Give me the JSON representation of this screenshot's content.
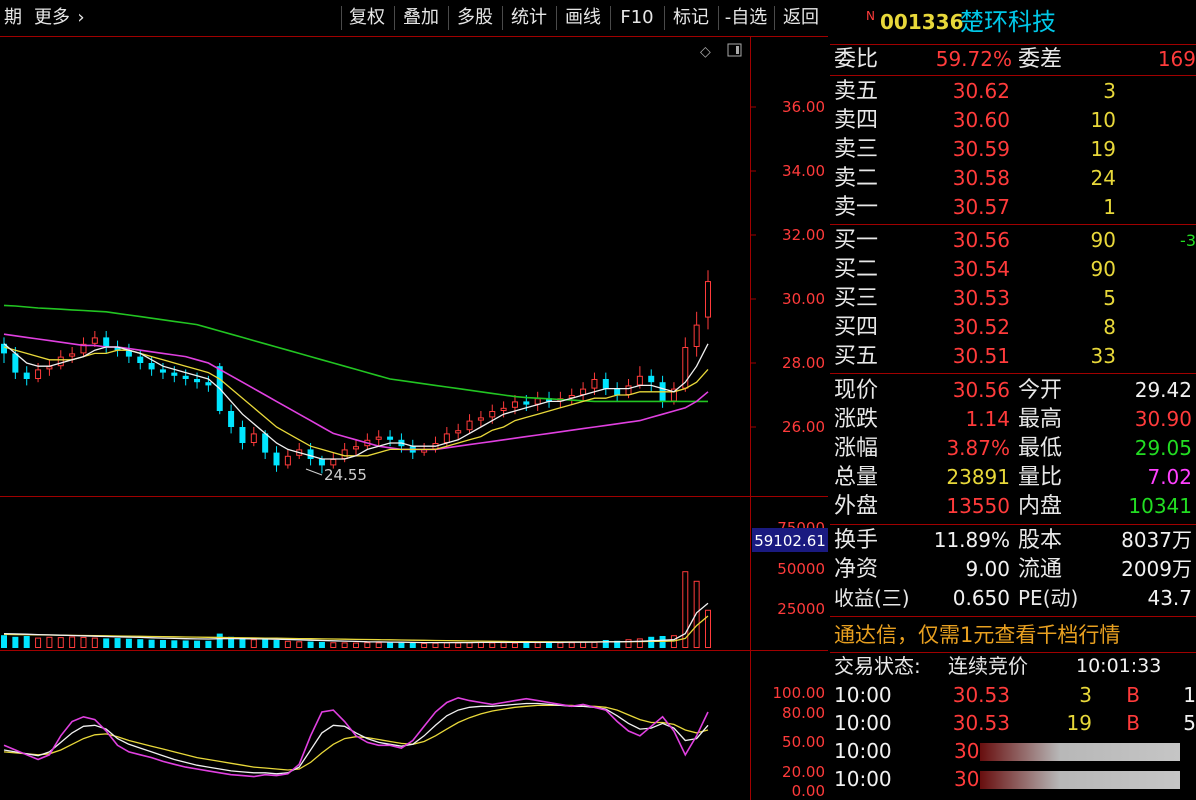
{
  "toolbar": {
    "left_cut": "期",
    "more": "更多",
    "buttons": [
      "复权",
      "叠加",
      "多股",
      "统计",
      "画线",
      "F10",
      "标记",
      "-自选",
      "返回"
    ]
  },
  "chart_labels": {
    "price_ticks": [
      "36.00",
      "34.00",
      "32.00",
      "30.00",
      "28.00",
      "26.00"
    ],
    "low_mark": "24.55",
    "vol_ticks": [
      "75000",
      "50000",
      "25000"
    ],
    "vol_cursor": "59102.61",
    "kdj_ticks": [
      "100.00",
      "80.00",
      "50.00",
      "20.00",
      "0.00"
    ]
  },
  "chart_data": {
    "type": "candlestick",
    "ylim": [
      24.0,
      37.0
    ],
    "candles": [
      [
        28.6,
        28.3,
        28.8,
        28.0
      ],
      [
        28.3,
        27.7,
        28.5,
        27.5
      ],
      [
        27.7,
        27.5,
        27.9,
        27.3
      ],
      [
        27.5,
        27.8,
        28.0,
        27.4
      ],
      [
        27.8,
        27.9,
        28.1,
        27.6
      ],
      [
        27.9,
        28.2,
        28.4,
        27.8
      ],
      [
        28.2,
        28.3,
        28.5,
        28.0
      ],
      [
        28.3,
        28.6,
        28.8,
        28.2
      ],
      [
        28.6,
        28.8,
        29.0,
        28.5
      ],
      [
        28.8,
        28.5,
        29.0,
        28.3
      ],
      [
        28.5,
        28.4,
        28.7,
        28.2
      ],
      [
        28.4,
        28.2,
        28.6,
        28.0
      ],
      [
        28.2,
        28.0,
        28.4,
        27.8
      ],
      [
        28.0,
        27.8,
        28.2,
        27.6
      ],
      [
        27.8,
        27.7,
        28.0,
        27.5
      ],
      [
        27.7,
        27.6,
        27.9,
        27.4
      ],
      [
        27.6,
        27.5,
        27.8,
        27.3
      ],
      [
        27.5,
        27.4,
        27.7,
        27.2
      ],
      [
        27.4,
        27.3,
        27.6,
        27.1
      ],
      [
        27.9,
        26.5,
        28.0,
        26.4
      ],
      [
        26.5,
        26.0,
        26.7,
        25.8
      ],
      [
        26.0,
        25.5,
        26.2,
        25.3
      ],
      [
        25.5,
        25.8,
        26.0,
        25.4
      ],
      [
        25.8,
        25.2,
        25.9,
        25.0
      ],
      [
        25.2,
        24.8,
        25.4,
        24.6
      ],
      [
        24.8,
        25.1,
        25.3,
        24.7
      ],
      [
        25.1,
        25.3,
        25.5,
        25.0
      ],
      [
        25.3,
        25.0,
        25.5,
        24.8
      ],
      [
        25.0,
        24.8,
        25.1,
        24.55
      ],
      [
        24.8,
        25.0,
        25.2,
        24.7
      ],
      [
        25.0,
        25.3,
        25.5,
        24.9
      ],
      [
        25.3,
        25.4,
        25.6,
        25.1
      ],
      [
        25.4,
        25.6,
        25.8,
        25.3
      ],
      [
        25.6,
        25.7,
        25.9,
        25.4
      ],
      [
        25.7,
        25.6,
        25.9,
        25.4
      ],
      [
        25.6,
        25.4,
        25.8,
        25.2
      ],
      [
        25.4,
        25.2,
        25.6,
        25.0
      ],
      [
        25.2,
        25.3,
        25.5,
        25.1
      ],
      [
        25.3,
        25.5,
        25.7,
        25.2
      ],
      [
        25.5,
        25.8,
        26.0,
        25.4
      ],
      [
        25.8,
        25.9,
        26.1,
        25.6
      ],
      [
        25.9,
        26.2,
        26.4,
        25.8
      ],
      [
        26.2,
        26.3,
        26.5,
        26.0
      ],
      [
        26.3,
        26.5,
        26.7,
        26.1
      ],
      [
        26.5,
        26.6,
        26.8,
        26.3
      ],
      [
        26.6,
        26.8,
        27.0,
        26.4
      ],
      [
        26.8,
        26.7,
        27.0,
        26.5
      ],
      [
        26.7,
        26.9,
        27.1,
        26.5
      ],
      [
        26.9,
        26.8,
        27.1,
        26.6
      ],
      [
        26.8,
        26.9,
        27.1,
        26.6
      ],
      [
        26.9,
        27.0,
        27.2,
        26.7
      ],
      [
        27.0,
        27.2,
        27.4,
        26.8
      ],
      [
        27.2,
        27.5,
        27.7,
        27.0
      ],
      [
        27.5,
        27.2,
        27.7,
        27.0
      ],
      [
        27.2,
        27.0,
        27.4,
        26.8
      ],
      [
        27.0,
        27.3,
        27.5,
        26.9
      ],
      [
        27.3,
        27.6,
        27.9,
        27.2
      ],
      [
        27.6,
        27.4,
        27.8,
        27.1
      ],
      [
        27.4,
        26.8,
        27.6,
        26.6
      ],
      [
        26.8,
        27.2,
        27.4,
        26.7
      ],
      [
        27.2,
        28.5,
        28.8,
        27.1
      ],
      [
        28.5,
        29.2,
        29.6,
        28.2
      ],
      [
        29.42,
        30.56,
        30.9,
        29.05
      ]
    ],
    "ma_short": [
      28.6,
      28.3,
      28.0,
      27.9,
      27.9,
      28.0,
      28.1,
      28.2,
      28.4,
      28.5,
      28.5,
      28.4,
      28.3,
      28.1,
      27.9,
      27.8,
      27.7,
      27.6,
      27.5,
      27.2,
      26.8,
      26.4,
      26.1,
      25.8,
      25.5,
      25.3,
      25.2,
      25.1,
      25.0,
      25.0,
      25.0,
      25.1,
      25.3,
      25.4,
      25.5,
      25.5,
      25.4,
      25.4,
      25.4,
      25.5,
      25.6,
      25.8,
      26.0,
      26.2,
      26.4,
      26.5,
      26.6,
      26.7,
      26.8,
      26.8,
      26.9,
      27.0,
      27.1,
      27.2,
      27.2,
      27.2,
      27.3,
      27.3,
      27.2,
      27.1,
      27.4,
      27.9,
      28.6
    ],
    "ma_mid": [
      28.5,
      28.4,
      28.3,
      28.2,
      28.1,
      28.1,
      28.1,
      28.2,
      28.3,
      28.3,
      28.4,
      28.4,
      28.3,
      28.2,
      28.1,
      28.0,
      27.9,
      27.8,
      27.7,
      27.5,
      27.2,
      26.9,
      26.6,
      26.3,
      26.0,
      25.8,
      25.6,
      25.4,
      25.3,
      25.2,
      25.1,
      25.1,
      25.1,
      25.2,
      25.3,
      25.3,
      25.3,
      25.3,
      25.3,
      25.4,
      25.5,
      25.6,
      25.7,
      25.9,
      26.0,
      26.2,
      26.3,
      26.4,
      26.5,
      26.6,
      26.7,
      26.8,
      26.9,
      26.9,
      27.0,
      27.0,
      27.1,
      27.1,
      27.1,
      27.1,
      27.2,
      27.4,
      27.8
    ],
    "ma_long": [
      28.9,
      28.85,
      28.8,
      28.75,
      28.7,
      28.65,
      28.6,
      28.55,
      28.55,
      28.5,
      28.5,
      28.45,
      28.4,
      28.35,
      28.3,
      28.25,
      28.2,
      28.1,
      28.0,
      27.8,
      27.6,
      27.4,
      27.2,
      27.0,
      26.8,
      26.6,
      26.4,
      26.2,
      26.0,
      25.8,
      25.7,
      25.6,
      25.5,
      25.4,
      25.35,
      25.3,
      25.3,
      25.3,
      25.3,
      25.35,
      25.4,
      25.45,
      25.5,
      25.55,
      25.6,
      25.65,
      25.7,
      25.75,
      25.8,
      25.85,
      25.9,
      25.95,
      26.0,
      26.05,
      26.1,
      26.15,
      26.2,
      26.3,
      26.4,
      26.5,
      26.6,
      26.8,
      27.1
    ],
    "ma_green": [
      29.8,
      29.78,
      29.75,
      29.72,
      29.7,
      29.68,
      29.66,
      29.64,
      29.62,
      29.6,
      29.55,
      29.5,
      29.45,
      29.4,
      29.35,
      29.3,
      29.25,
      29.2,
      29.1,
      29.0,
      28.9,
      28.8,
      28.7,
      28.6,
      28.5,
      28.4,
      28.3,
      28.2,
      28.1,
      28.0,
      27.9,
      27.8,
      27.7,
      27.6,
      27.5,
      27.45,
      27.4,
      27.35,
      27.3,
      27.25,
      27.2,
      27.15,
      27.1,
      27.05,
      27.0,
      26.95,
      26.92,
      26.9,
      26.88,
      26.86,
      26.84,
      26.82,
      26.8,
      26.8,
      26.8,
      26.8,
      26.8,
      26.8,
      26.8,
      26.8,
      26.8,
      26.8,
      26.8
    ],
    "volume_ylim": [
      0,
      75000
    ],
    "volume": [
      8000,
      7000,
      7500,
      6500,
      7000,
      6800,
      7200,
      6900,
      6500,
      6000,
      6200,
      5800,
      5500,
      5200,
      5000,
      4800,
      4700,
      4600,
      4500,
      9000,
      7000,
      6000,
      5500,
      6000,
      5000,
      4500,
      4200,
      4000,
      3800,
      3600,
      3500,
      3400,
      3600,
      3500,
      3400,
      3300,
      3200,
      3100,
      3300,
      3500,
      3400,
      3600,
      3700,
      3500,
      3600,
      3400,
      3500,
      3600,
      3400,
      3500,
      3600,
      4000,
      3800,
      5000,
      4500,
      5500,
      6000,
      7000,
      7500,
      8000,
      48000,
      42000,
      23891
    ],
    "volume_ma": [
      9000,
      8800,
      8600,
      8400,
      8200,
      8000,
      7800,
      7600,
      7400,
      7200,
      7000,
      6800,
      6600,
      6400,
      6200,
      6000,
      5800,
      5700,
      5600,
      5800,
      5900,
      5800,
      5700,
      5600,
      5500,
      5300,
      5100,
      4900,
      4700,
      4500,
      4300,
      4100,
      3900,
      3800,
      3700,
      3600,
      3500,
      3400,
      3400,
      3400,
      3400,
      3400,
      3500,
      3500,
      3500,
      3500,
      3500,
      3500,
      3500,
      3500,
      3600,
      3600,
      3700,
      3800,
      3900,
      4000,
      4200,
      4500,
      4800,
      5200,
      9000,
      22000,
      28000
    ],
    "volume_ma2": [
      8500,
      8400,
      8300,
      8200,
      8100,
      8000,
      7900,
      7800,
      7700,
      7600,
      7500,
      7400,
      7300,
      7200,
      7100,
      7000,
      6900,
      6800,
      6700,
      6600,
      6500,
      6400,
      6300,
      6200,
      6100,
      6000,
      5900,
      5800,
      5700,
      5600,
      5500,
      5400,
      5300,
      5200,
      5100,
      5000,
      4900,
      4800,
      4700,
      4600,
      4500,
      4400,
      4300,
      4200,
      4100,
      4000,
      3950,
      3900,
      3850,
      3800,
      3800,
      3800,
      3800,
      3850,
      3900,
      3950,
      4000,
      4100,
      4200,
      4400,
      6000,
      14000,
      20000
    ],
    "kdj_ylim": [
      0,
      110
    ],
    "kdj_j": [
      45,
      40,
      35,
      30,
      35,
      55,
      70,
      75,
      72,
      60,
      45,
      38,
      35,
      32,
      28,
      25,
      22,
      20,
      18,
      16,
      14,
      13,
      12,
      14,
      13,
      15,
      25,
      55,
      80,
      82,
      70,
      55,
      48,
      45,
      45,
      42,
      50,
      65,
      80,
      90,
      95,
      92,
      90,
      88,
      90,
      92,
      94,
      92,
      90,
      88,
      86,
      88,
      85,
      82,
      70,
      60,
      55,
      65,
      75,
      60,
      35,
      55,
      80
    ],
    "kdj_k": [
      40,
      38,
      36,
      34,
      38,
      48,
      58,
      65,
      66,
      62,
      52,
      46,
      42,
      38,
      34,
      30,
      27,
      24,
      22,
      20,
      18,
      17,
      16,
      16,
      15,
      16,
      22,
      40,
      58,
      66,
      65,
      58,
      52,
      48,
      46,
      44,
      46,
      55,
      66,
      76,
      82,
      85,
      86,
      86,
      87,
      88,
      89,
      89,
      88,
      87,
      86,
      86,
      85,
      83,
      76,
      68,
      62,
      63,
      68,
      63,
      50,
      52,
      66
    ],
    "kdj_d": [
      38,
      37,
      36,
      35,
      36,
      40,
      46,
      52,
      56,
      57,
      54,
      50,
      47,
      44,
      41,
      38,
      35,
      32,
      30,
      28,
      26,
      24,
      22,
      21,
      20,
      19,
      20,
      27,
      37,
      46,
      52,
      54,
      53,
      51,
      49,
      47,
      46,
      49,
      55,
      62,
      69,
      74,
      78,
      81,
      83,
      85,
      86,
      87,
      87,
      87,
      87,
      86,
      86,
      85,
      82,
      77,
      72,
      69,
      69,
      67,
      61,
      58,
      61
    ]
  },
  "stock": {
    "flag": "N",
    "code": "001336",
    "name": "楚环科技"
  },
  "weibi": {
    "label": "委比",
    "value": "59.72%",
    "diff_label": "委差",
    "diff_value": "169"
  },
  "asks": [
    {
      "label": "卖五",
      "price": "30.62",
      "vol": "3"
    },
    {
      "label": "卖四",
      "price": "30.60",
      "vol": "10"
    },
    {
      "label": "卖三",
      "price": "30.59",
      "vol": "19"
    },
    {
      "label": "卖二",
      "price": "30.58",
      "vol": "24"
    },
    {
      "label": "卖一",
      "price": "30.57",
      "vol": "1"
    }
  ],
  "bids": [
    {
      "label": "买一",
      "price": "30.56",
      "vol": "90",
      "extra": "-3"
    },
    {
      "label": "买二",
      "price": "30.54",
      "vol": "90",
      "extra": ""
    },
    {
      "label": "买三",
      "price": "30.53",
      "vol": "5",
      "extra": ""
    },
    {
      "label": "买四",
      "price": "30.52",
      "vol": "8",
      "extra": ""
    },
    {
      "label": "买五",
      "price": "30.51",
      "vol": "33",
      "extra": ""
    }
  ],
  "quote": [
    {
      "l1": "现价",
      "v1": "30.56",
      "l2": "今开",
      "v2": "29.42"
    },
    {
      "l1": "涨跌",
      "v1": "1.14",
      "l2": "最高",
      "v2": "30.90"
    },
    {
      "l1": "涨幅",
      "v1": "3.87%",
      "l2": "最低",
      "v2": "29.05"
    },
    {
      "l1": "总量",
      "v1": "23891",
      "l2": "量比",
      "v2": "7.02"
    },
    {
      "l1": "外盘",
      "v1": "13550",
      "l2": "内盘",
      "v2": "10341"
    }
  ],
  "fund": [
    {
      "l1": "换手",
      "v1": "11.89%",
      "l2": "股本",
      "v2": "8037万"
    },
    {
      "l1": "净资",
      "v1": "9.00",
      "l2": "流通",
      "v2": "2009万"
    },
    {
      "l1": "收益(三)",
      "v1": "0.650",
      "l2": "PE(动)",
      "v2": "43.7"
    }
  ],
  "promo": "通达信，仅需1元查看千档行情",
  "trade_status": {
    "label": "交易状态:",
    "value": "连续竞价",
    "time": "10:01:33"
  },
  "ticks": [
    {
      "time": "10:00",
      "price": "30.53",
      "vol": "3",
      "side": "B",
      "extra": "1"
    },
    {
      "time": "10:00",
      "price": "30.53",
      "vol": "19",
      "side": "B",
      "extra": "5"
    },
    {
      "time": "10:00",
      "price": "30",
      "vol": "",
      "side": "",
      "extra": ""
    },
    {
      "time": "10:00",
      "price": "30",
      "vol": "",
      "side": "",
      "extra": ""
    }
  ],
  "colors": {
    "up": "#ff3b3b",
    "down": "#00e5ff",
    "grid": "#a00000"
  }
}
